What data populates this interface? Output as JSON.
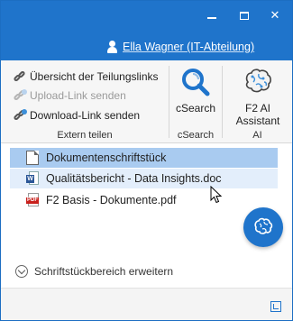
{
  "window": {
    "minimize_glyph": "",
    "maximize_glyph": "",
    "close_glyph": "✕"
  },
  "user": {
    "name": "Ella Wagner (IT-Abteilung)",
    "icon": "user-icon"
  },
  "ribbon": {
    "extern_teilen": {
      "items": [
        {
          "label": "Übersicht der Teilungslinks",
          "icon": "link-icon",
          "enabled": true
        },
        {
          "label": "Upload-Link senden",
          "icon": "link-icon",
          "enabled": false
        },
        {
          "label": "Download-Link senden",
          "icon": "link-icon",
          "enabled": true
        }
      ],
      "group_label": "Extern teilen"
    },
    "csearch": {
      "button_label": "cSearch",
      "group_label": "cSearch",
      "icon": "search-icon"
    },
    "ai": {
      "button_label_line1": "F2 AI",
      "button_label_line2": "Assistant",
      "group_label": "AI",
      "icon": "brain-icon"
    }
  },
  "documents": [
    {
      "name": "Dokumentenschriftstück",
      "icon": "blank-document-icon",
      "state": "selected"
    },
    {
      "name": "Qualitätsbericht - Data Insights.doc",
      "icon": "word-document-icon",
      "state": "hover"
    },
    {
      "name": "F2 Basis - Dokumente.pdf",
      "icon": "pdf-document-icon",
      "state": "normal"
    }
  ],
  "expand_label": "Schriftstückbereich erweitern",
  "fab_icon": "brain-icon",
  "colors": {
    "accent": "#1f74cb",
    "selected_row": "#a9cbf0",
    "hover_row": "#e3eefb"
  }
}
